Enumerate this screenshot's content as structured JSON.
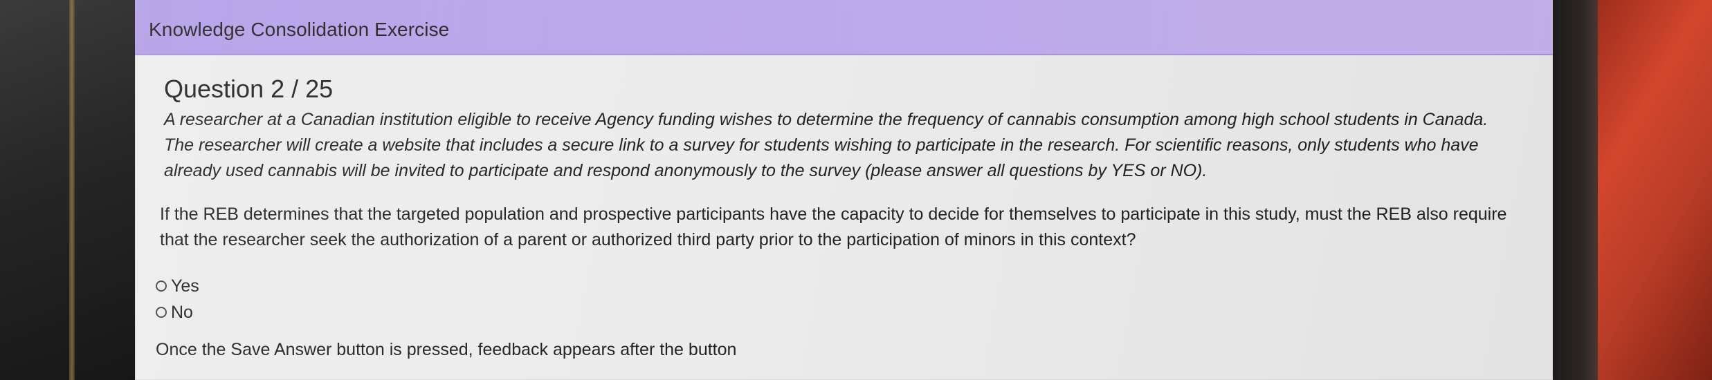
{
  "header": {
    "title": "Knowledge Consolidation Exercise"
  },
  "question": {
    "title": "Question 2 / 25",
    "scenario": "A researcher at a Canadian institution eligible to receive Agency funding wishes to determine the frequency of cannabis consumption among high school students in Canada. The researcher will create a website that includes a secure link to a survey for students wishing to participate in the research. For scientific reasons, only students who have already used cannabis will be invited to participate and respond anonymously to the survey (please answer all questions by YES or NO).",
    "prompt": "If the REB determines that the targeted population and prospective participants have the capacity to decide for themselves to participate in this study, must the REB also require that the researcher seek the authorization of a parent or authorized third party prior to the participation of minors in this context?",
    "options": [
      {
        "label": "Yes"
      },
      {
        "label": "No"
      }
    ],
    "feedback_note": "Once the Save Answer button is pressed, feedback appears after the button"
  },
  "colors": {
    "header_bg": "#c8b4f0",
    "panel_bg": "#ececec",
    "text": "#202020"
  },
  "icons": {
    "option": "radio-button-icon"
  }
}
